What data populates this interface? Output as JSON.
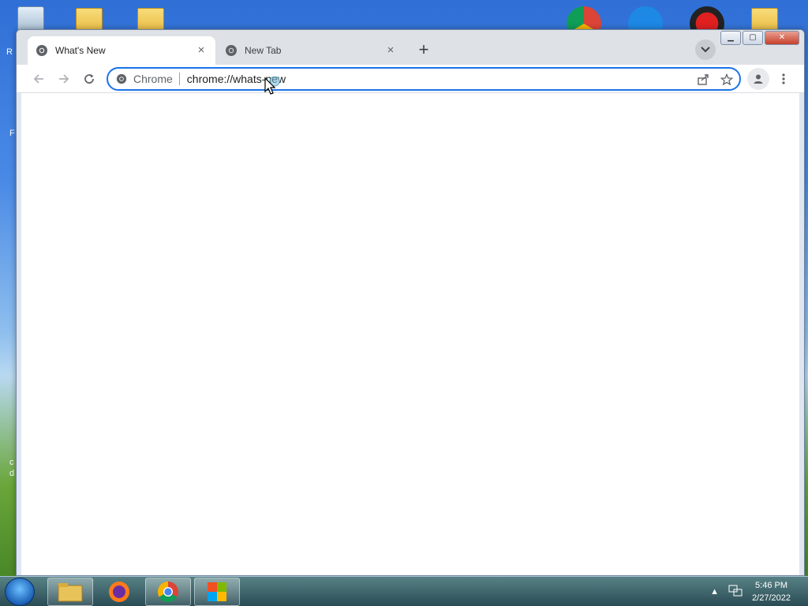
{
  "browser": {
    "tabs": [
      {
        "title": "What's New",
        "active": true
      },
      {
        "title": "New Tab",
        "active": false
      }
    ],
    "new_tab_symbol": "+",
    "close_symbol": "×",
    "omnibox": {
      "chip": "Chrome",
      "url": "chrome://whats-new"
    },
    "window_controls": {
      "minimize": "▁",
      "maximize": "▢",
      "close": "✕"
    }
  },
  "desktop": {
    "left_edge_letters": [
      "R",
      "F",
      "c",
      "d"
    ]
  },
  "taskbar": {
    "clock": {
      "time": "5:46 PM",
      "date": "2/27/2022"
    },
    "tray_arrow": "▲"
  },
  "icons": [
    "chrome-favicon",
    "back-icon",
    "forward-icon",
    "reload-icon",
    "share-icon",
    "star-icon",
    "profile-icon",
    "menu-icon",
    "tab-search-icon",
    "windows-start-icon",
    "file-explorer-icon",
    "firefox-icon",
    "chrome-icon",
    "office-icon",
    "network-icon"
  ],
  "colors": {
    "accent": "#1a73e8",
    "tab_strip": "#dee1e6",
    "page_bg": "#ffffff"
  }
}
